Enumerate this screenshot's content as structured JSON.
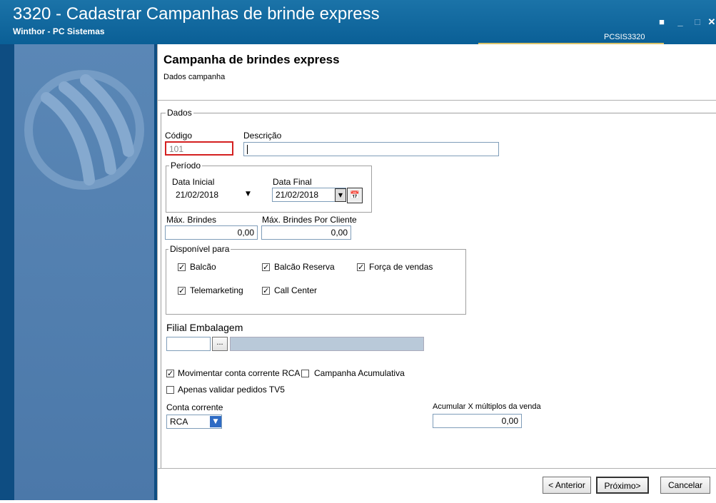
{
  "window": {
    "title": "3320 - Cadastrar Campanhas de brinde express",
    "subtitle": "Winthor - PC Sistemas",
    "routine_code": "PCSIS3320"
  },
  "page": {
    "heading": "Campanha de brindes express",
    "subheading": "Dados campanha"
  },
  "dados": {
    "legend": "Dados",
    "codigo_label": "Código",
    "codigo_value": "101",
    "descricao_label": "Descrição",
    "descricao_value": ""
  },
  "periodo": {
    "legend": "Período",
    "data_inicial_label": "Data Inicial",
    "data_inicial_value": "21/02/2018",
    "data_final_label": "Data Final",
    "data_final_value": "21/02/2018"
  },
  "brindes": {
    "max_label": "Máx. Brindes",
    "max_value": "0,00",
    "max_cliente_label": "Máx. Brindes Por Cliente",
    "max_cliente_value": "0,00"
  },
  "disponivel": {
    "legend": "Disponível para",
    "balcao": "Balcão",
    "balcao_reserva": "Balcão Reserva",
    "forca_vendas": "Força de vendas",
    "telemarketing": "Telemarketing",
    "call_center": "Call Center"
  },
  "filial": {
    "label": "Filial Embalagem",
    "code_value": "",
    "lookup_label": "...",
    "name_value": ""
  },
  "options": {
    "movimentar": "Movimentar conta corrente RCA",
    "acumulativa": "Campanha Acumulativa",
    "validar_tv5": "Apenas validar pedidos TV5"
  },
  "conta": {
    "label": "Conta corrente",
    "value": "RCA",
    "acumular_label": "Acumular X múltiplos da venda",
    "acumular_value": "0,00"
  },
  "buttons": {
    "anterior": "< Anterior",
    "proximo": "Próximo>",
    "cancelar": "Cancelar"
  }
}
